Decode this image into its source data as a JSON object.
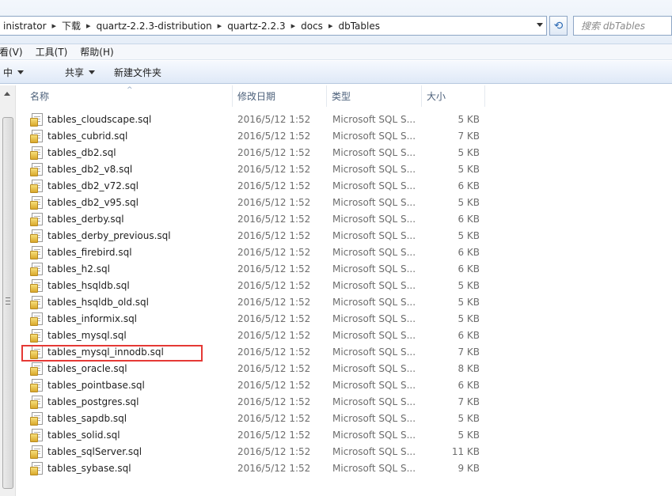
{
  "address": {
    "crumbs": [
      "inistrator",
      "下载",
      "quartz-2.2.3-distribution",
      "quartz-2.2.3",
      "docs",
      "dbTables"
    ],
    "separator": "▸"
  },
  "search": {
    "placeholder": "搜索 dbTables"
  },
  "menu": [
    "看(V)",
    "工具(T)",
    "帮助(H)"
  ],
  "commands": {
    "organize": "中",
    "share": "共享",
    "new_folder": "新建文件夹"
  },
  "columns": {
    "name": "名称",
    "date": "修改日期",
    "type": "类型",
    "size": "大小"
  },
  "files": [
    {
      "name": "tables_cloudscape.sql",
      "date": "2016/5/12 1:52",
      "type": "Microsoft SQL S...",
      "size": "5 KB"
    },
    {
      "name": "tables_cubrid.sql",
      "date": "2016/5/12 1:52",
      "type": "Microsoft SQL S...",
      "size": "7 KB"
    },
    {
      "name": "tables_db2.sql",
      "date": "2016/5/12 1:52",
      "type": "Microsoft SQL S...",
      "size": "5 KB"
    },
    {
      "name": "tables_db2_v8.sql",
      "date": "2016/5/12 1:52",
      "type": "Microsoft SQL S...",
      "size": "5 KB"
    },
    {
      "name": "tables_db2_v72.sql",
      "date": "2016/5/12 1:52",
      "type": "Microsoft SQL S...",
      "size": "6 KB"
    },
    {
      "name": "tables_db2_v95.sql",
      "date": "2016/5/12 1:52",
      "type": "Microsoft SQL S...",
      "size": "5 KB"
    },
    {
      "name": "tables_derby.sql",
      "date": "2016/5/12 1:52",
      "type": "Microsoft SQL S...",
      "size": "6 KB"
    },
    {
      "name": "tables_derby_previous.sql",
      "date": "2016/5/12 1:52",
      "type": "Microsoft SQL S...",
      "size": "5 KB"
    },
    {
      "name": "tables_firebird.sql",
      "date": "2016/5/12 1:52",
      "type": "Microsoft SQL S...",
      "size": "6 KB"
    },
    {
      "name": "tables_h2.sql",
      "date": "2016/5/12 1:52",
      "type": "Microsoft SQL S...",
      "size": "6 KB"
    },
    {
      "name": "tables_hsqldb.sql",
      "date": "2016/5/12 1:52",
      "type": "Microsoft SQL S...",
      "size": "5 KB"
    },
    {
      "name": "tables_hsqldb_old.sql",
      "date": "2016/5/12 1:52",
      "type": "Microsoft SQL S...",
      "size": "5 KB"
    },
    {
      "name": "tables_informix.sql",
      "date": "2016/5/12 1:52",
      "type": "Microsoft SQL S...",
      "size": "5 KB"
    },
    {
      "name": "tables_mysql.sql",
      "date": "2016/5/12 1:52",
      "type": "Microsoft SQL S...",
      "size": "6 KB"
    },
    {
      "name": "tables_mysql_innodb.sql",
      "date": "2016/5/12 1:52",
      "type": "Microsoft SQL S...",
      "size": "7 KB"
    },
    {
      "name": "tables_oracle.sql",
      "date": "2016/5/12 1:52",
      "type": "Microsoft SQL S...",
      "size": "8 KB"
    },
    {
      "name": "tables_pointbase.sql",
      "date": "2016/5/12 1:52",
      "type": "Microsoft SQL S...",
      "size": "6 KB"
    },
    {
      "name": "tables_postgres.sql",
      "date": "2016/5/12 1:52",
      "type": "Microsoft SQL S...",
      "size": "7 KB"
    },
    {
      "name": "tables_sapdb.sql",
      "date": "2016/5/12 1:52",
      "type": "Microsoft SQL S...",
      "size": "5 KB"
    },
    {
      "name": "tables_solid.sql",
      "date": "2016/5/12 1:52",
      "type": "Microsoft SQL S...",
      "size": "5 KB"
    },
    {
      "name": "tables_sqlServer.sql",
      "date": "2016/5/12 1:52",
      "type": "Microsoft SQL S...",
      "size": "11 KB"
    },
    {
      "name": "tables_sybase.sql",
      "date": "2016/5/12 1:52",
      "type": "Microsoft SQL S...",
      "size": "9 KB"
    }
  ],
  "highlighted_file": "tables_mysql_innodb.sql",
  "colors": {
    "highlight_border": "#e53935",
    "header_text": "#4c607a"
  },
  "icons": {
    "refresh": "refresh-icon",
    "file": "sql-file-icon"
  }
}
